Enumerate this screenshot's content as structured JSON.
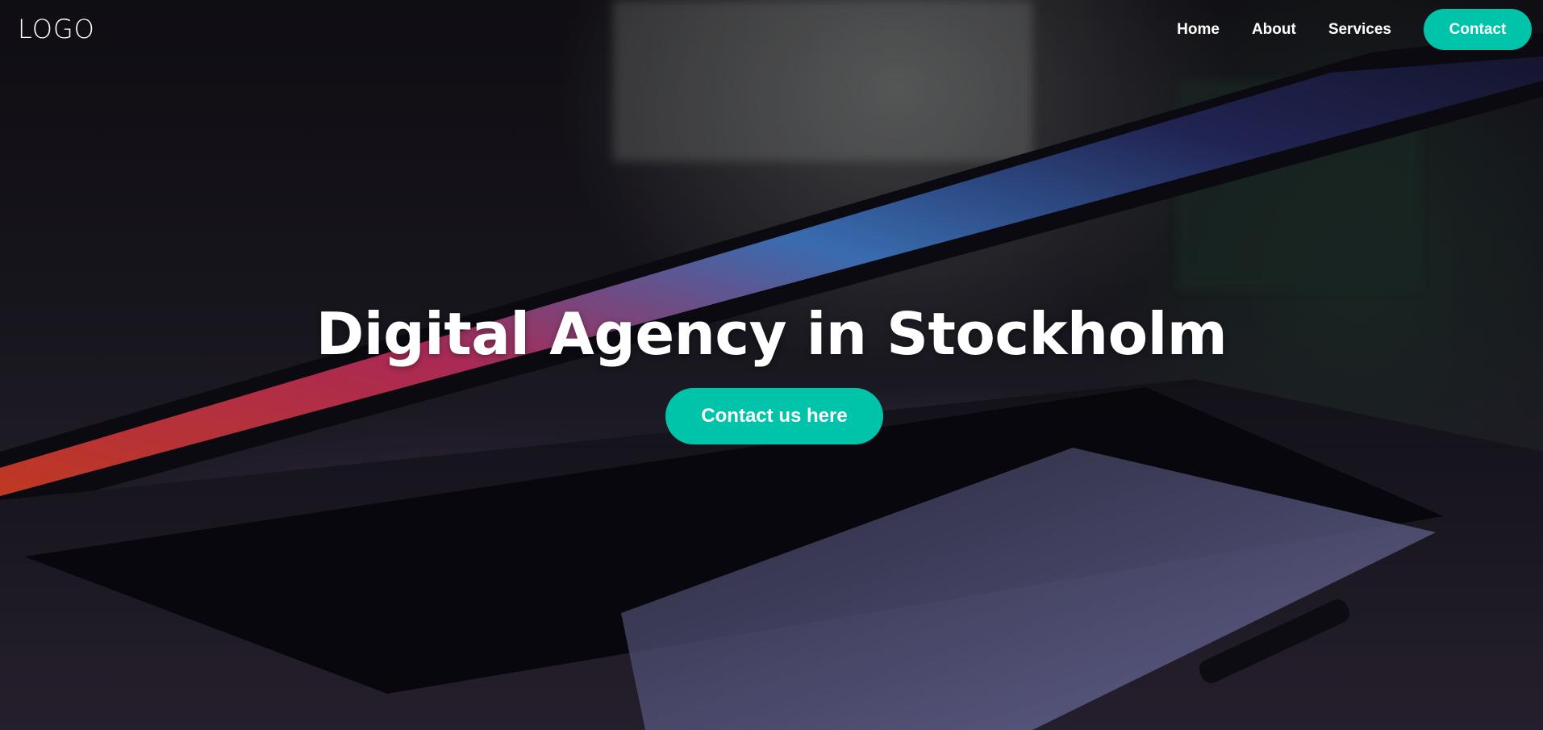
{
  "nav": {
    "logo": "LOGO",
    "links": [
      "Home",
      "About",
      "Services"
    ],
    "contact": "Contact"
  },
  "hero": {
    "title": "Digital Agency in Stockholm",
    "cta": "Contact us here",
    "background": "laptop-photo-background"
  },
  "colors": {
    "accent": "#00c4aa",
    "text": "#ffffff"
  }
}
